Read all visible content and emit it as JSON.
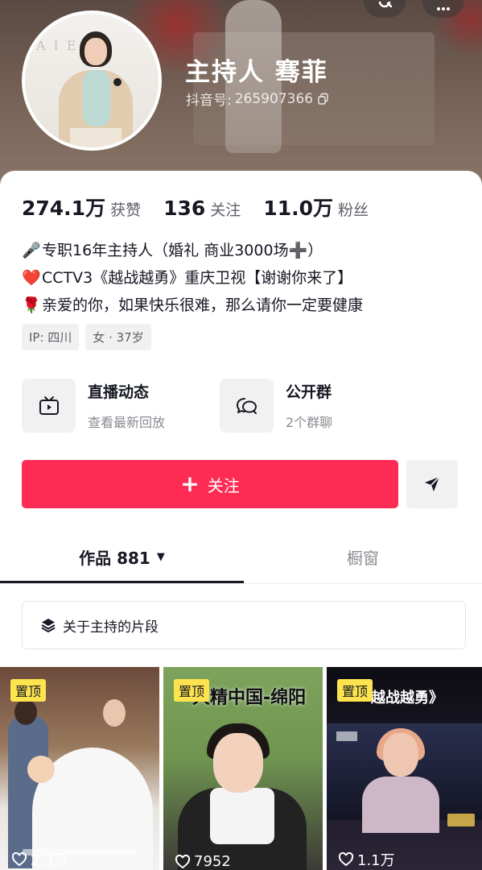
{
  "profile": {
    "name": "主持人 骞菲",
    "douyin_id_label": "抖音号:",
    "douyin_id": "265907366"
  },
  "stats": [
    {
      "value": "274.1万",
      "label": "获赞"
    },
    {
      "value": "136",
      "label": "关注"
    },
    {
      "value": "11.0万",
      "label": "粉丝"
    }
  ],
  "bio": [
    {
      "emoji": "🎤",
      "text": "专职16年主持人（婚礼 商业3000场➕）"
    },
    {
      "emoji": "❤️",
      "text": "CCTV3《越战越勇》重庆卫视【谢谢你来了】"
    },
    {
      "emoji": "🌹",
      "text": "亲爱的你，如果快乐很难，那么请你一定要健康"
    }
  ],
  "tags": [
    "IP: 四川",
    "女 · 37岁"
  ],
  "features": [
    {
      "title": "直播动态",
      "subtitle": "查看最新回放",
      "icon": "tv-icon"
    },
    {
      "title": "公开群",
      "subtitle": "2个群聊",
      "icon": "chat-group-icon"
    }
  ],
  "actions": {
    "follow_label": "关注"
  },
  "tabs": {
    "works_label": "作品 881",
    "showcase_label": "橱窗"
  },
  "collection": {
    "label": "关于主持的片段"
  },
  "videos": [
    {
      "pinned_label": "置顶",
      "likes": "2.3万",
      "cover_title": ""
    },
    {
      "pinned_label": "置顶",
      "likes": "7952",
      "cover_title": "大精中国-绵阳"
    },
    {
      "pinned_label": "置顶",
      "likes": "1.1万",
      "cover_title": "越战越勇》"
    }
  ],
  "colors": {
    "accent": "#fe2c55",
    "pin": "#fde34e",
    "text": "#161823",
    "muted": "#8a8b91"
  }
}
